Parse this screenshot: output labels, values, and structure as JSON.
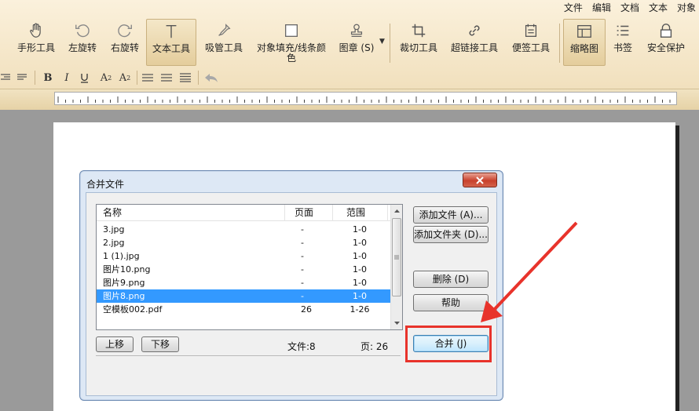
{
  "menubar": [
    "文件",
    "编辑",
    "文档",
    "文本",
    "对象"
  ],
  "toolbar": {
    "tools": [
      {
        "id": "hand",
        "label": "手形工具",
        "icon": "hand-icon"
      },
      {
        "id": "rotate-left",
        "label": "左旋转",
        "icon": "rotate-left-icon"
      },
      {
        "id": "rotate-right",
        "label": "右旋转",
        "icon": "rotate-right-icon"
      },
      {
        "id": "text",
        "label": "文本工具",
        "icon": "text-cursor-icon",
        "active": true
      },
      {
        "id": "eyedropper",
        "label": "吸管工具",
        "icon": "eyedropper-icon"
      },
      {
        "id": "fill",
        "label_line1": "对象填充/线条颜",
        "label_line2": "色",
        "icon": "fill-square-icon"
      },
      {
        "id": "stamp",
        "label": "图章 (S)",
        "icon": "stamp-icon"
      },
      {
        "id": "crop",
        "label": "裁切工具",
        "icon": "crop-icon"
      },
      {
        "id": "hyperlink",
        "label": "超链接工具",
        "icon": "link-icon"
      },
      {
        "id": "note",
        "label": "便签工具",
        "icon": "note-icon"
      },
      {
        "id": "thumbnail",
        "label": "缩略图",
        "icon": "thumbnail-icon",
        "active": true
      },
      {
        "id": "bookmark",
        "label": "书签",
        "icon": "bookmark-list-icon"
      },
      {
        "id": "security",
        "label": "安全保护",
        "icon": "lock-icon"
      }
    ],
    "format": {
      "bold": "B",
      "italic": "I",
      "superscript": "A",
      "superscript_mark": "2",
      "subscript": "A",
      "subscript_mark": "2"
    }
  },
  "dialog": {
    "title": "合并文件",
    "columns": {
      "name": "名称",
      "pages": "页面",
      "range": "范围"
    },
    "files": [
      {
        "name": "3.jpg",
        "pages": "-",
        "range": "1-0",
        "selected": false
      },
      {
        "name": "2.jpg",
        "pages": "-",
        "range": "1-0",
        "selected": false
      },
      {
        "name": "1 (1).jpg",
        "pages": "-",
        "range": "1-0",
        "selected": false
      },
      {
        "name": "图片10.png",
        "pages": "-",
        "range": "1-0",
        "selected": false
      },
      {
        "name": "图片9.png",
        "pages": "-",
        "range": "1-0",
        "selected": false
      },
      {
        "name": "图片8.png",
        "pages": "-",
        "range": "1-0",
        "selected": true
      },
      {
        "name": "空模板002.pdf",
        "pages": "26",
        "range": "1-26",
        "selected": false
      }
    ],
    "buttons": {
      "add_file": "添加文件 (A)...",
      "add_folder": "添加文件夹 (D)...",
      "delete": "删除 (D)",
      "help": "帮助",
      "merge": "合并 (J)",
      "move_up": "上移",
      "move_down": "下移"
    },
    "status": {
      "files": "文件:8",
      "pages": "页: 26"
    }
  },
  "colors": {
    "accent": "#e8332b",
    "selection": "#3399ff"
  }
}
